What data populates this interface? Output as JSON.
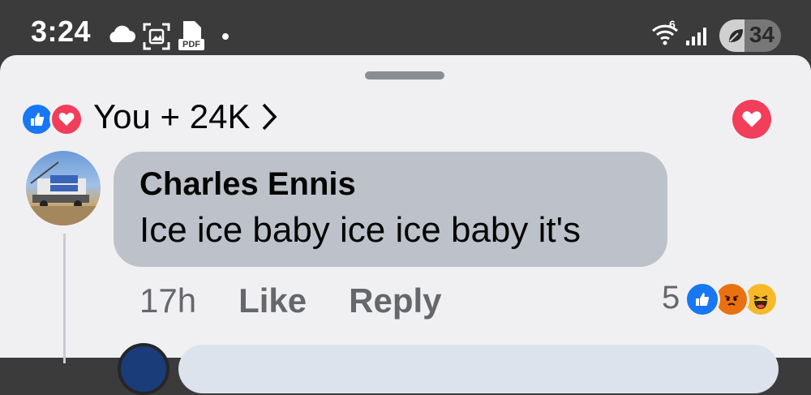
{
  "status_bar": {
    "time": "3:24",
    "icons": [
      "cloud-icon",
      "screenshot-icon",
      "pdf-icon",
      "notification-dot-icon",
      "wifi-6-icon",
      "signal-icon"
    ],
    "pdf_label": "PDF",
    "wifi_label": "6",
    "battery_level": "34",
    "battery_fraction": 0.34
  },
  "reactions_summary": {
    "text": "You + 24K",
    "icons": [
      "like-reaction-icon",
      "love-reaction-icon"
    ]
  },
  "comment": {
    "author": "Charles Ennis",
    "text": "Ice ice baby ice ice baby it's",
    "time": "17h",
    "like_label": "Like",
    "reply_label": "Reply",
    "reaction_count": "5",
    "reaction_icons": [
      "like-reaction-icon",
      "angry-reaction-icon",
      "haha-reaction-icon"
    ]
  },
  "colors": {
    "like_blue": "#1877f2",
    "love_red": "#f23d5b",
    "sheet_bg": "#f0f0f2",
    "bubble_bg": "#bdc2ca"
  }
}
